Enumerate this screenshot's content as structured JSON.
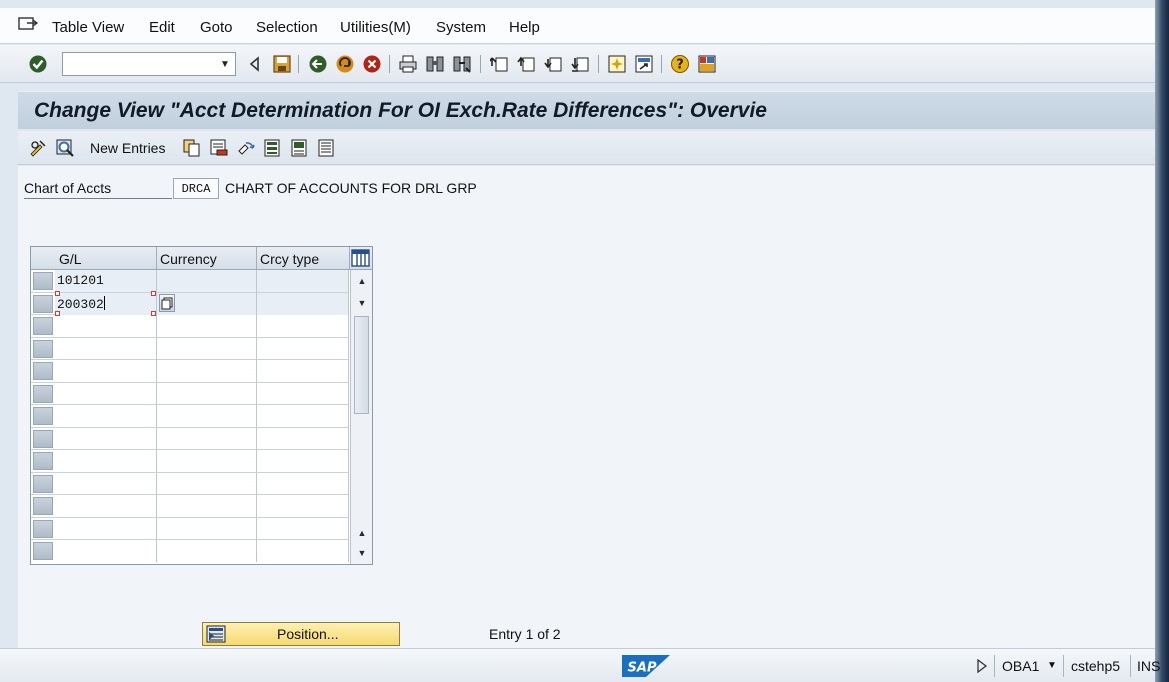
{
  "menu": {
    "items": [
      "Table View",
      "Edit",
      "Goto",
      "Selection",
      "Utilities(M)",
      "System",
      "Help"
    ]
  },
  "toolbar": {
    "command_field_value": "",
    "icons": [
      "enter-icon",
      "back-icon",
      "save-icon",
      "back-green-icon",
      "exit-icon",
      "cancel-icon",
      "print-icon",
      "find-icon",
      "find-next-icon",
      "first-page-icon",
      "prev-page-icon",
      "next-page-icon",
      "last-page-icon",
      "create-session-icon",
      "shortcut-icon",
      "help-icon",
      "customize-layout-icon"
    ]
  },
  "title": "Change View \"Acct Determination For OI Exch.Rate Differences\": Overvie",
  "app_toolbar": {
    "new_entries_label": "New Entries"
  },
  "chart_of_accounts": {
    "label": "Chart of Accts",
    "value": "DRCA",
    "description": "CHART OF ACCOUNTS FOR DRL GRP"
  },
  "table": {
    "columns": [
      "G/L",
      "Currency",
      "Crcy type"
    ],
    "rows": [
      {
        "gl": "101201",
        "currency": "",
        "crcy_type": ""
      },
      {
        "gl": "200302",
        "currency": "",
        "crcy_type": ""
      }
    ]
  },
  "position_button_label": "Position...",
  "entry_text": "Entry 1 of 2",
  "statusbar": {
    "transaction": "OBA1",
    "server": "cstehp5",
    "mode": "INS"
  }
}
